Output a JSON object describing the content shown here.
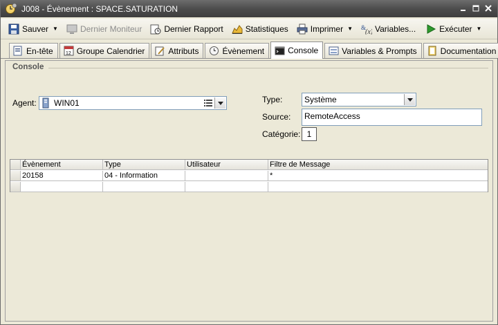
{
  "window": {
    "title": "J008 - Évènement : SPACE.SATURATION",
    "icon": "clock-gear-icon"
  },
  "toolbar": {
    "save": "Sauver",
    "last_monitor": "Dernier Moniteur",
    "last_report": "Dernier Rapport",
    "statistics": "Statistiques",
    "print": "Imprimer",
    "variables": "Variables...",
    "execute": "Exécuter"
  },
  "tabs": [
    {
      "label": "En-tête",
      "icon": "header-doc-icon"
    },
    {
      "label": "Groupe Calendrier",
      "icon": "calendar-icon"
    },
    {
      "label": "Attributs",
      "icon": "attributes-icon"
    },
    {
      "label": "Évènement",
      "icon": "event-clock-icon"
    },
    {
      "label": "Console",
      "icon": "console-icon",
      "active": true
    },
    {
      "label": "Variables & Prompts",
      "icon": "variables-icon"
    },
    {
      "label": "Documentation",
      "icon": "documentation-icon"
    },
    {
      "label": "[+]",
      "icon": "add-tab-icon"
    }
  ],
  "console": {
    "group_title": "Console",
    "agent_label": "Agent:",
    "agent_value": "WIN01",
    "type_label": "Type:",
    "type_value": "Système",
    "source_label": "Source:",
    "source_value": "RemoteAccess",
    "category_label": "Catégorie:",
    "category_value": "1"
  },
  "grid": {
    "columns": [
      "Évènement",
      "Type",
      "Utilisateur",
      "Filtre de Message"
    ],
    "rows": [
      [
        "20158",
        "04 - Information",
        "",
        "*"
      ],
      [
        "",
        "",
        "",
        ""
      ]
    ]
  }
}
